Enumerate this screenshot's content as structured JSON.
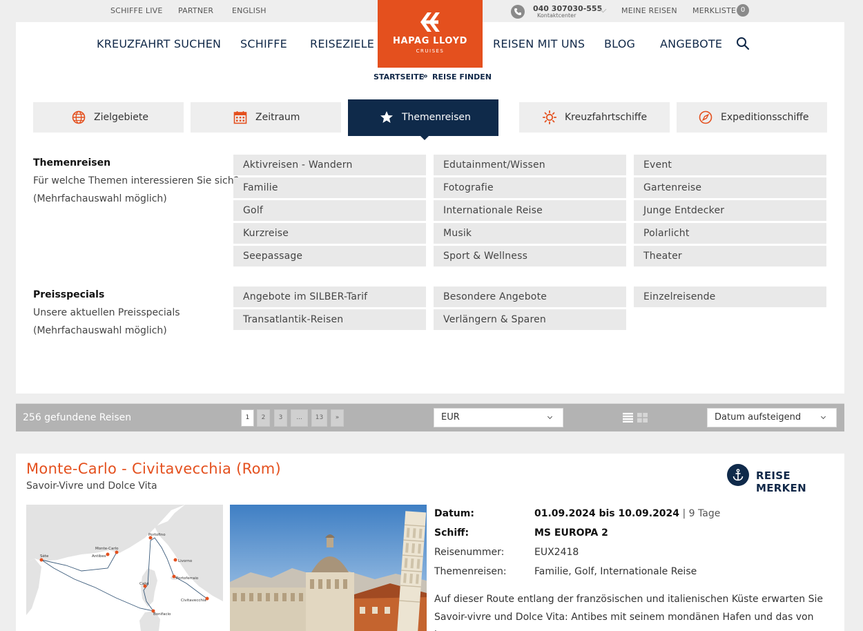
{
  "topbar": {
    "links": [
      "SCHIFFE LIVE",
      "PARTNER",
      "ENGLISH"
    ],
    "phone": "040 307030-555",
    "phone_sub": "Kontaktcenter",
    "meine_reisen": "MEINE REISEN",
    "merkliste": "MERKLISTE",
    "merkliste_count": "0"
  },
  "nav": {
    "items_left": [
      "KREUZFAHRT SUCHEN",
      "SCHIFFE",
      "REISEZIELE"
    ],
    "items_right": [
      "REISEN MIT UNS",
      "BLOG",
      "ANGEBOTE"
    ],
    "logo_line1": "HAPAG LLOYD",
    "logo_line2": "CRUISES",
    "brand_color": "#e4501e",
    "navy": "#0f2a4a"
  },
  "breadcrumb": [
    "STARTSEITE",
    "»",
    "REISE FINDEN"
  ],
  "tabs": [
    {
      "label": "Zielgebiete",
      "icon": "globe-icon",
      "active": false
    },
    {
      "label": "Zeitraum",
      "icon": "calendar-icon",
      "active": false
    },
    {
      "label": "Themenreisen",
      "icon": "star-icon",
      "active": true
    },
    {
      "label": "Kreuzfahrtschiffe",
      "icon": "sun-icon",
      "active": false
    },
    {
      "label": "Expeditionsschiffe",
      "icon": "compass-icon",
      "active": false
    }
  ],
  "themen": {
    "title": "Themenreisen",
    "text1": "Für welche Themen interessieren Sie sich?",
    "text2": "(Mehrfachauswahl möglich)",
    "options": [
      "Aktivreisen - Wandern",
      "Edutainment/Wissen",
      "Event",
      "Familie",
      "Fotografie",
      "Gartenreise",
      "Golf",
      "Internationale Reise",
      "Junge Entdecker",
      "Kurzreise",
      "Musik",
      "Polarlicht",
      "Seepassage",
      "Sport & Wellness",
      "Theater"
    ]
  },
  "preis": {
    "title": "Preisspecials",
    "text1": "Unsere aktuellen Preisspecials",
    "text2": "(Mehrfachauswahl möglich)",
    "options": [
      "Angebote im SILBER-Tarif",
      "Besondere Angebote",
      "Einzelreisende",
      "Transatlantik-Reisen",
      "Verlängern & Sparen"
    ]
  },
  "results": {
    "count": "256 gefundene Reisen",
    "pages": [
      "1",
      "2",
      "3",
      "...",
      "13",
      "»"
    ],
    "currency": "EUR",
    "sort": "Datum aufsteigend"
  },
  "trip": {
    "title": "Monte-Carlo - Civitavecchia (Rom)",
    "subtitle": "Savoir-Vivre und Dolce Vita",
    "merken": "REISE MERKEN",
    "label_datum": "Datum:",
    "datum": "01.09.2024 bis 10.09.2024",
    "dauer": " | 9 Tage",
    "label_schiff": "Schiff:",
    "schiff": "MS EUROPA 2",
    "label_nummer": "Reisenummer:",
    "nummer": "EUX2418",
    "label_themen": "Themenreisen:",
    "themen": "Familie, Golf, Internationale Reise",
    "description": "Auf dieser Route entlang der französischen und italienischen Küste erwarten Sie Savoir-vivre und Dolce Vita: Antibes mit seinem mondänen Hafen und das von bunten",
    "ports": [
      "Portofino",
      "Monte-Carlo",
      "Antibes",
      "Sète",
      "Livorno",
      "Portoferraio",
      "Calvi",
      "Civitavecchia",
      "Bonifacio"
    ]
  }
}
